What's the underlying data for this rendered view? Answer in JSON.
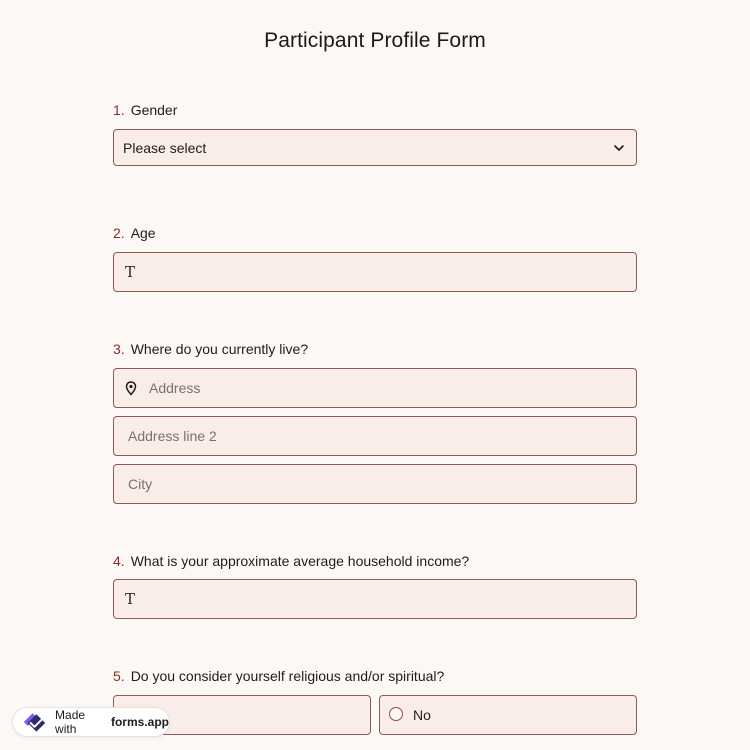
{
  "form": {
    "title": "Participant Profile Form"
  },
  "questions": [
    {
      "number": "1.",
      "label": "Gender",
      "type": "select",
      "selected": "Please select"
    },
    {
      "number": "2.",
      "label": "Age",
      "type": "text",
      "icon": "text-type-icon"
    },
    {
      "number": "3.",
      "label": "Where do you currently live?",
      "type": "address",
      "placeholders": {
        "address": "Address",
        "line2": "Address line 2",
        "city": "City"
      }
    },
    {
      "number": "4.",
      "label": "What is your approximate average household income?",
      "type": "text",
      "icon": "text-type-icon"
    },
    {
      "number": "5.",
      "label": "Do you consider yourself religious and/or spiritual?",
      "type": "radio",
      "options": [
        "",
        "No"
      ]
    }
  ],
  "badge": {
    "prefix": "Made with",
    "brand": "forms.app"
  },
  "colors": {
    "background": "#fcf8f5",
    "field_bg": "#f9ede9",
    "field_border": "#8f5a55",
    "number_accent": "#8a2d25",
    "logo_purple": "#7b5bf0"
  }
}
